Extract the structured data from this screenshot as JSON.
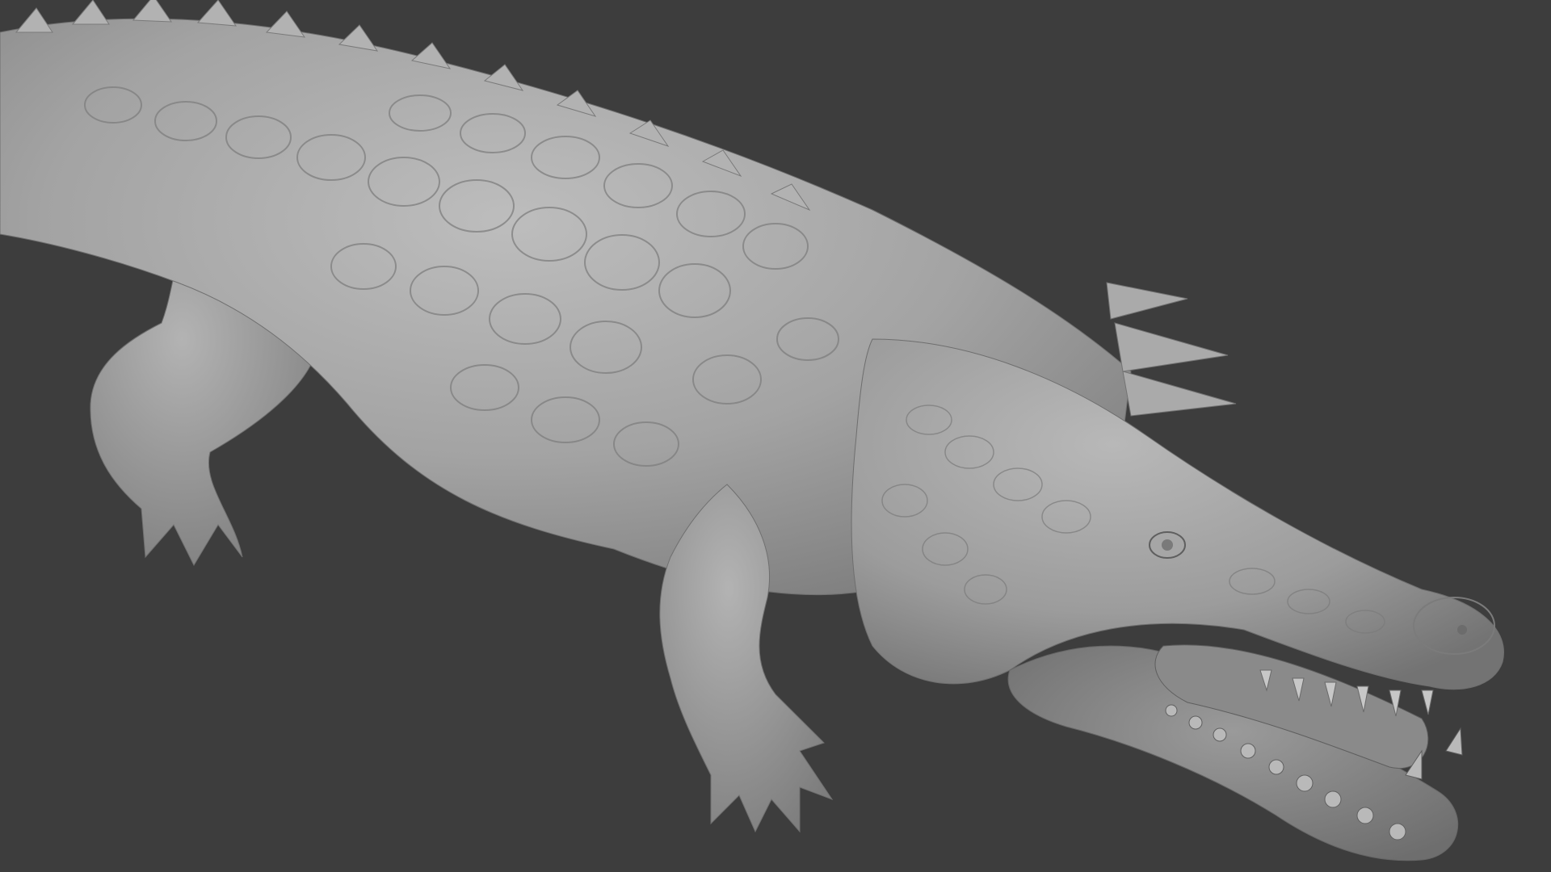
{
  "viewport": {
    "background_color": "#3d3d3d",
    "subject": "crocodile-sculpt",
    "material_color": "#9e9e9e",
    "shadow_color": "#6a6a6a",
    "highlight_color": "#c4c4c4"
  }
}
